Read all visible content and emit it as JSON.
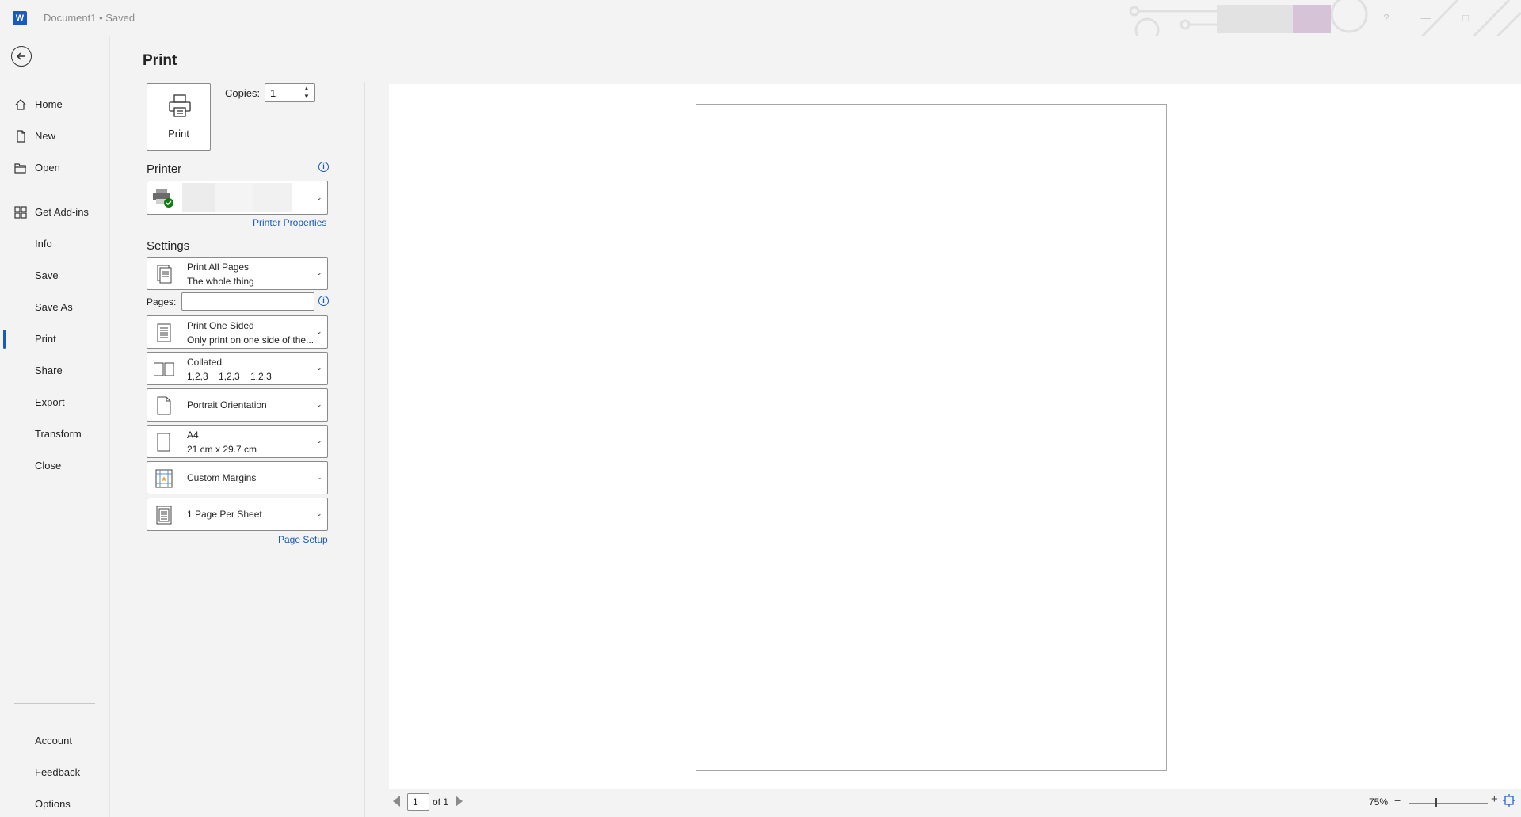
{
  "titlebar": {
    "app_logo": "W",
    "doc_title": "Document1 • Saved",
    "help": "?",
    "minimize": "—",
    "restore": "□"
  },
  "nav": {
    "items": [
      {
        "label": "Home",
        "icon": "home-icon"
      },
      {
        "label": "New",
        "icon": "new-document-icon"
      },
      {
        "label": "Open",
        "icon": "folder-open-icon"
      },
      {
        "label": "Get Add-ins",
        "icon": "grid-icon"
      },
      {
        "label": "Info"
      },
      {
        "label": "Save"
      },
      {
        "label": "Save As"
      },
      {
        "label": "Print",
        "active": true
      },
      {
        "label": "Share"
      },
      {
        "label": "Export"
      },
      {
        "label": "Transform"
      },
      {
        "label": "Close"
      }
    ],
    "bottom_items": [
      {
        "label": "Account"
      },
      {
        "label": "Feedback"
      },
      {
        "label": "Options"
      }
    ]
  },
  "print": {
    "title": "Print",
    "print_button_label": "Print",
    "copies_label": "Copies:",
    "copies_value": "1",
    "printer_section": "Printer",
    "printer_properties_link": "Printer Properties",
    "info_glyph": "i",
    "settings_section": "Settings",
    "pages_label": "Pages:",
    "pages_value": "",
    "page_setup_link": "Page Setup",
    "settings": [
      {
        "line1": "Print All Pages",
        "line2": "The whole thing",
        "icon": "document-pages-icon"
      },
      {
        "line1": "Print One Sided",
        "line2": "Only print on one side of the...",
        "icon": "one-sided-icon"
      },
      {
        "line1": "Collated",
        "line2": "1,2,3    1,2,3    1,2,3",
        "icon": "collated-icon"
      },
      {
        "line1": "Portrait Orientation",
        "icon": "portrait-icon"
      },
      {
        "line1": "A4",
        "line2": "21 cm x 29.7 cm",
        "icon": "paper-size-icon"
      },
      {
        "line1": "Custom Margins",
        "icon": "margins-icon"
      },
      {
        "line1": "1 Page Per Sheet",
        "icon": "pages-per-sheet-icon"
      }
    ]
  },
  "preview": {
    "current_page": "1",
    "of_pages": "of 1",
    "zoom": "75%",
    "zoom_minus": "−",
    "zoom_plus": "+"
  },
  "colors": {
    "accent": "#185abd",
    "background": "#f3f3f3"
  }
}
